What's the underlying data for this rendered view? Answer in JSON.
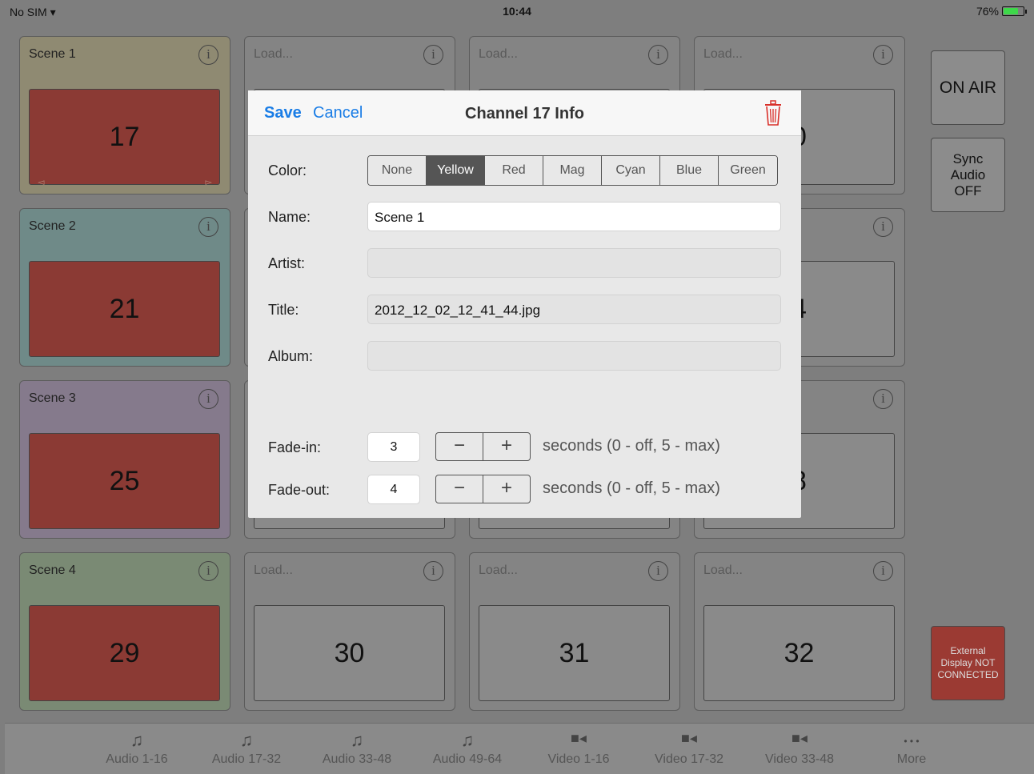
{
  "status": {
    "carrier": "No SIM",
    "time": "10:44",
    "battery": "76%"
  },
  "tiles": [
    {
      "name": "Scene 1",
      "num": "17",
      "red": true,
      "load": false
    },
    {
      "name": "Load...",
      "num": "",
      "red": false,
      "load": true
    },
    {
      "name": "Load...",
      "num": "",
      "red": false,
      "load": true
    },
    {
      "name": "Load...",
      "num": "0",
      "red": false,
      "load": true
    },
    {
      "name": "Scene 2",
      "num": "21",
      "red": true,
      "load": false
    },
    {
      "name": "",
      "num": "",
      "red": false,
      "load": true
    },
    {
      "name": "",
      "num": "",
      "red": false,
      "load": true
    },
    {
      "name": "",
      "num": "4",
      "red": false,
      "load": true
    },
    {
      "name": "Scene 3",
      "num": "25",
      "red": true,
      "load": false
    },
    {
      "name": "",
      "num": "",
      "red": false,
      "load": true
    },
    {
      "name": "",
      "num": "",
      "red": false,
      "load": true
    },
    {
      "name": "",
      "num": "8",
      "red": false,
      "load": true
    },
    {
      "name": "Scene 4",
      "num": "29",
      "red": true,
      "load": false
    },
    {
      "name": "Load...",
      "num": "30",
      "red": false,
      "load": true
    },
    {
      "name": "Load...",
      "num": "31",
      "red": false,
      "load": true
    },
    {
      "name": "Load...",
      "num": "32",
      "red": false,
      "load": true
    }
  ],
  "side": {
    "on_air": "ON AIR",
    "sync_audio": "Sync Audio OFF",
    "external": "External Display NOT CONNECTED"
  },
  "tabs": [
    {
      "label": "Audio 1-16",
      "icon": "music-note-icon"
    },
    {
      "label": "Audio 17-32",
      "icon": "music-note-icon"
    },
    {
      "label": "Audio 33-48",
      "icon": "music-note-icon"
    },
    {
      "label": "Audio 49-64",
      "icon": "music-note-icon"
    },
    {
      "label": "Video 1-16",
      "icon": "video-camera-icon"
    },
    {
      "label": "Video 17-32",
      "icon": "video-camera-icon"
    },
    {
      "label": "Video 33-48",
      "icon": "video-camera-icon"
    },
    {
      "label": "More",
      "icon": "ellipsis-icon"
    }
  ],
  "modal": {
    "save": "Save",
    "cancel": "Cancel",
    "title": "Channel 17 Info",
    "color_label": "Color:",
    "colors": [
      "None",
      "Yellow",
      "Red",
      "Mag",
      "Cyan",
      "Blue",
      "Green"
    ],
    "selected_color": "Yellow",
    "name_label": "Name:",
    "name_value": "Scene 1",
    "artist_label": "Artist:",
    "artist_value": "",
    "title_label": "Title:",
    "title_value": "2012_12_02_12_41_44.jpg",
    "album_label": "Album:",
    "album_value": "",
    "fadein_label": "Fade-in:",
    "fadein_value": "3",
    "fadeout_label": "Fade-out:",
    "fadeout_value": "4",
    "hint": "seconds (0 - off, 5 - max)",
    "minus": "−",
    "plus": "+"
  },
  "colors": {
    "accent": "#1a7de6",
    "danger": "#d9302a",
    "pad_red": "#8b3a34"
  }
}
